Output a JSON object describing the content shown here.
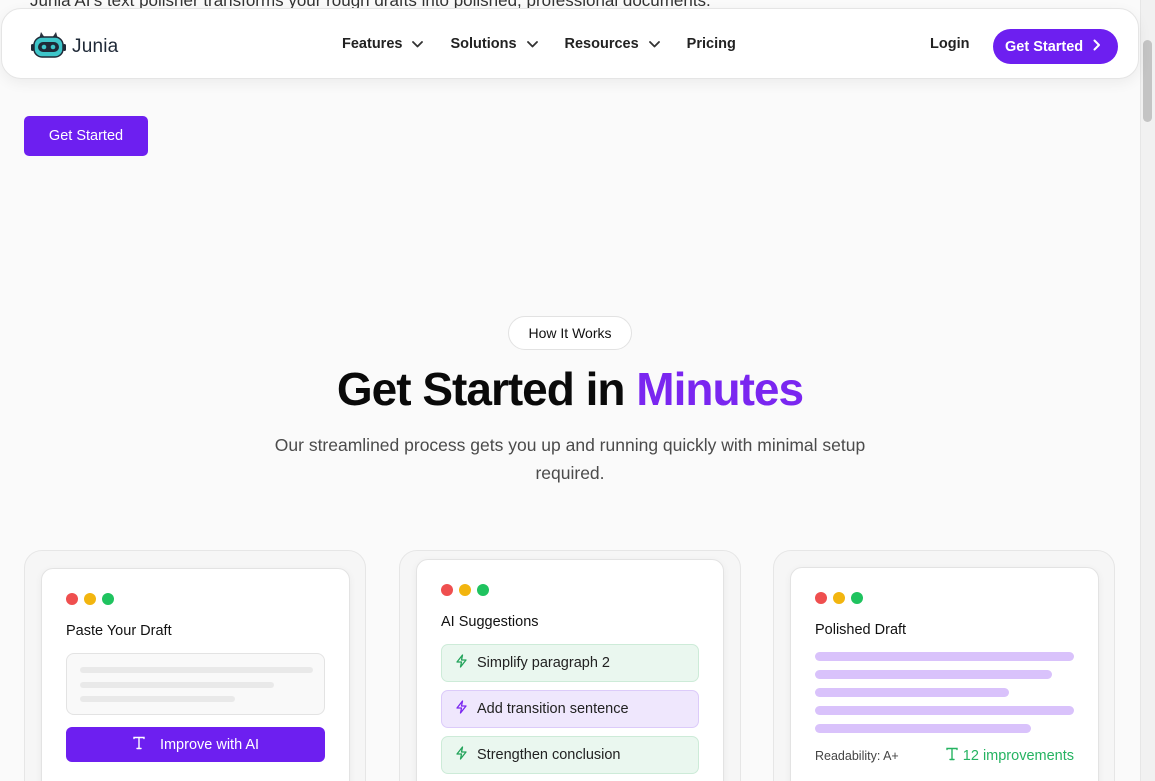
{
  "header": {
    "logo_text": "Junia",
    "nav": [
      {
        "label": "Features",
        "has_dropdown": true
      },
      {
        "label": "Solutions",
        "has_dropdown": true
      },
      {
        "label": "Resources",
        "has_dropdown": true
      },
      {
        "label": "Pricing",
        "has_dropdown": false
      }
    ],
    "login_label": "Login",
    "cta_label": "Get Started"
  },
  "top_text_cutoff": "Junia AI's text polisher transforms your rough drafts into polished, professional documents.",
  "hero": {
    "cta_label": "Get Started"
  },
  "how_it_works": {
    "pill": "How It Works",
    "heading_main": "Get Started in",
    "heading_accent": "Minutes",
    "subtext": "Our streamlined process gets you up and running quickly with minimal setup required."
  },
  "cards": [
    {
      "title": "Paste Your Draft",
      "button_label": "Improve with AI"
    },
    {
      "title": "AI Suggestions",
      "suggestions": [
        "Simplify paragraph 2",
        "Add transition sentence",
        "Strengthen conclusion"
      ]
    },
    {
      "title": "Polished Draft",
      "readability": "Readability: A+",
      "improvements": "12 improvements"
    }
  ],
  "colors": {
    "brand": "#6d1ff0",
    "accent_text": "#7a26f0",
    "dot_red": "#ef4f4f",
    "dot_yellow": "#f2b50f",
    "dot_green": "#1fc35f",
    "improvement_green": "#25b361"
  },
  "icons": {
    "chevron": "chevron-down-icon",
    "cta_arrow": "chevron-right-icon",
    "text": "text-type-icon",
    "bolt": "lightning-bolt-icon"
  }
}
